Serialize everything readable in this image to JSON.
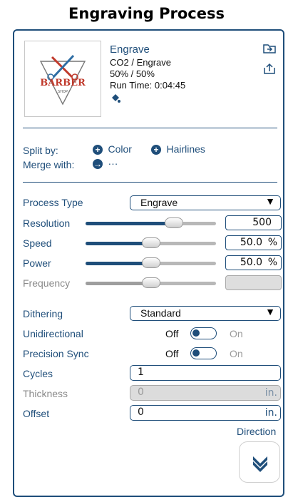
{
  "title": "Engraving Process",
  "header": {
    "name": "Engrave",
    "material": "CO2 / Engrave",
    "percent": "50% / 50%",
    "run_time": "Run Time: 0:04:45"
  },
  "thumbnail": {
    "top_text": "BARBER",
    "bottom_text": "SHOP"
  },
  "split": {
    "label": "Split by:",
    "color": "Color",
    "hairlines": "Hairlines"
  },
  "merge": {
    "label": "Merge with:",
    "dots": "···"
  },
  "process_type": {
    "label": "Process Type",
    "value": "Engrave"
  },
  "resolution": {
    "label": "Resolution",
    "slider": 0.68,
    "value": "500",
    "unit": ""
  },
  "speed": {
    "label": "Speed",
    "slider": 0.5,
    "value": "50.0",
    "unit": "%"
  },
  "power": {
    "label": "Power",
    "slider": 0.5,
    "value": "50.0",
    "unit": "%"
  },
  "frequency": {
    "label": "Frequency",
    "slider": 0.5,
    "value": ""
  },
  "dithering": {
    "label": "Dithering",
    "value": "Standard"
  },
  "unidirectional": {
    "label": "Unidirectional",
    "off": "Off",
    "on": "On"
  },
  "precision_sync": {
    "label": "Precision Sync",
    "off": "Off",
    "on": "On"
  },
  "cycles": {
    "label": "Cycles",
    "value": "1"
  },
  "thickness": {
    "label": "Thickness",
    "value": "0",
    "unit": "in."
  },
  "offset": {
    "label": "Offset",
    "value": "0",
    "unit": "in."
  },
  "direction": {
    "label": "Direction"
  },
  "colors": {
    "accent": "#1f4e7a",
    "disabled": "#dcdcdc"
  }
}
